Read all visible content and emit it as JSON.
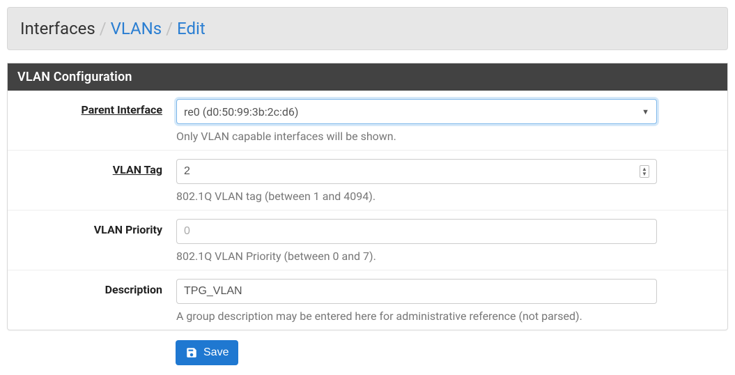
{
  "breadcrumb": {
    "root": "Interfaces",
    "l1": "VLANs",
    "l2": "Edit"
  },
  "panel": {
    "title": "VLAN Configuration"
  },
  "fields": {
    "parent_if": {
      "label": "Parent Interface",
      "value": "re0 (d0:50:99:3b:2c:d6)",
      "help": "Only VLAN capable interfaces will be shown."
    },
    "vlan_tag": {
      "label": "VLAN Tag",
      "value": "2",
      "help": "802.1Q VLAN tag (between 1 and 4094)."
    },
    "vlan_prio": {
      "label": "VLAN Priority",
      "placeholder": "0",
      "value": "",
      "help": "802.1Q VLAN Priority (between 0 and 7)."
    },
    "descr": {
      "label": "Description",
      "value": "TPG_VLAN",
      "help": "A group description may be entered here for administrative reference (not parsed)."
    }
  },
  "actions": {
    "save": "Save"
  }
}
